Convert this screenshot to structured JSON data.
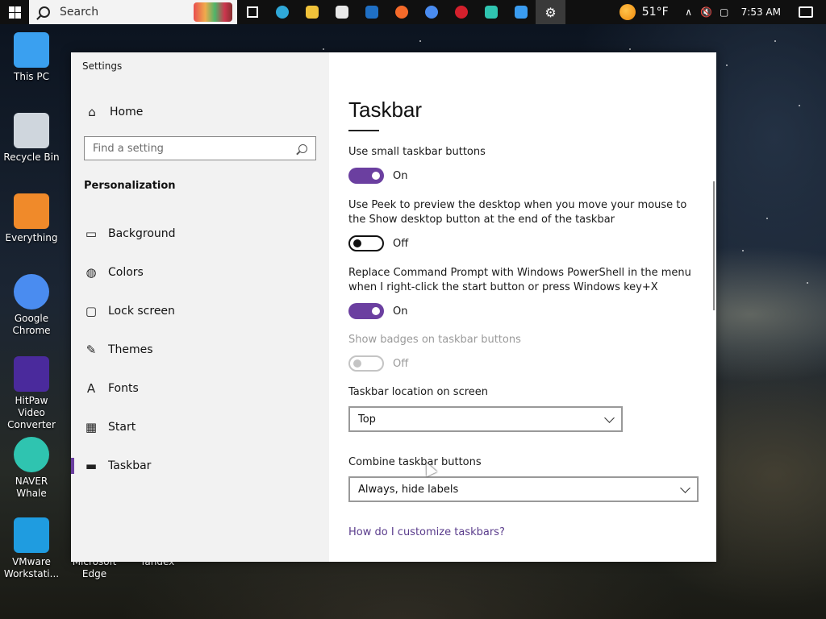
{
  "taskbar": {
    "search_label": "Search",
    "apps": [
      {
        "name": "task-view",
        "color": "#ffffff"
      },
      {
        "name": "edge",
        "color": "#2fa8d8"
      },
      {
        "name": "file-explorer",
        "color": "#f0c23a"
      },
      {
        "name": "microsoft-store",
        "color": "#e8e8e8"
      },
      {
        "name": "outlook",
        "color": "#1f6fc4"
      },
      {
        "name": "firefox",
        "color": "#f56a2a"
      },
      {
        "name": "chrome",
        "color": "#4a8cf0"
      },
      {
        "name": "opera",
        "color": "#d3202c"
      },
      {
        "name": "whale",
        "color": "#2fc4b0"
      },
      {
        "name": "wave-browser",
        "color": "#3a9cf0"
      },
      {
        "name": "settings",
        "color": "#ffffff"
      }
    ],
    "weather_temp": "51°F",
    "time": "7:53 AM"
  },
  "desktop_icons": [
    {
      "label": "This PC",
      "icon": "computer-icon",
      "color": "#3aa0f0"
    },
    {
      "label": "Recycle Bin",
      "icon": "recycle-bin-icon",
      "color": "#cfd6dd"
    },
    {
      "label": "Everything",
      "icon": "everything-search-icon",
      "color": "#f08a2a"
    },
    {
      "label": "Google Chrome",
      "icon": "chrome-icon",
      "color": "#4a8cf0"
    },
    {
      "label": "HitPaw Video Converter",
      "icon": "hitpaw-icon",
      "color": "#4a2a9c"
    },
    {
      "label": "NAVER Whale",
      "icon": "whale-icon",
      "color": "#2fc4b0"
    },
    {
      "label": "VMware Workstati...",
      "icon": "vmware-icon",
      "color": "#1f9ce0"
    },
    {
      "label": "Microsoft Edge",
      "icon": "edge-icon",
      "color": "#2fa8d8"
    },
    {
      "label": "Yandex",
      "icon": "yandex-icon",
      "color": "#e8e8e8"
    }
  ],
  "settings": {
    "window_title": "Settings",
    "home_label": "Home",
    "find_placeholder": "Find a setting",
    "section_label": "Personalization",
    "nav_items": [
      {
        "label": "Background",
        "icon": "picture-icon"
      },
      {
        "label": "Colors",
        "icon": "palette-icon"
      },
      {
        "label": "Lock screen",
        "icon": "lock-screen-icon"
      },
      {
        "label": "Themes",
        "icon": "brush-icon"
      },
      {
        "label": "Fonts",
        "icon": "fonts-icon"
      },
      {
        "label": "Start",
        "icon": "start-icon"
      },
      {
        "label": "Taskbar",
        "icon": "taskbar-icon"
      }
    ],
    "selected_nav": "Taskbar",
    "page_title": "Taskbar",
    "options": [
      {
        "label": "Use small taskbar buttons",
        "state": "On",
        "enabled": true
      },
      {
        "label": "Use Peek to preview the desktop when you move your mouse to the Show desktop button at the end of the taskbar",
        "state": "Off",
        "enabled": true
      },
      {
        "label": "Replace Command Prompt with Windows PowerShell in the menu when I right-click the start button or press Windows key+X",
        "state": "On",
        "enabled": true
      },
      {
        "label": "Show badges on taskbar buttons",
        "state": "Off",
        "enabled": false
      }
    ],
    "location_label": "Taskbar location on screen",
    "location_value": "Top",
    "combine_label": "Combine taskbar buttons",
    "combine_value": "Always, hide labels",
    "help_link": "How do I customize taskbars?",
    "accent_color": "#6b3fa0"
  }
}
